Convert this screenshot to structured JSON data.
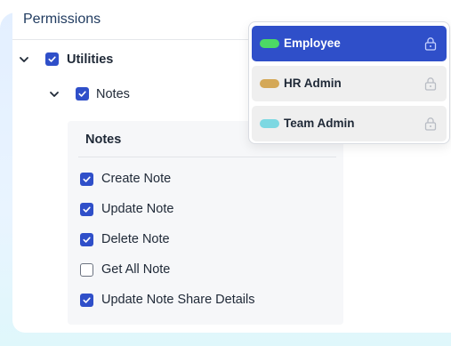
{
  "header": {
    "title": "Permissions"
  },
  "tree": {
    "utilities": {
      "label": "Utilities",
      "checked": true
    },
    "notes": {
      "label": "Notes",
      "checked": true
    }
  },
  "notes_panel": {
    "title": "Notes",
    "items": [
      {
        "label": "Create Note",
        "checked": true
      },
      {
        "label": "Update Note",
        "checked": true
      },
      {
        "label": "Delete Note",
        "checked": true
      },
      {
        "label": "Get All Note",
        "checked": false
      },
      {
        "label": "Update Note Share Details",
        "checked": true
      }
    ]
  },
  "roles": [
    {
      "name": "Employee",
      "color": "#4cd964",
      "selected": true,
      "icon": "lock-icon"
    },
    {
      "name": "HR Admin",
      "color": "#d4a857",
      "selected": false,
      "icon": "lock-icon"
    },
    {
      "name": "Team Admin",
      "color": "#7dd8e2",
      "selected": false,
      "icon": "lock-icon"
    }
  ],
  "colors": {
    "accent": "#2f4fc9",
    "title": "#1f3a5f",
    "panel_bg": "#f6f7f9"
  }
}
